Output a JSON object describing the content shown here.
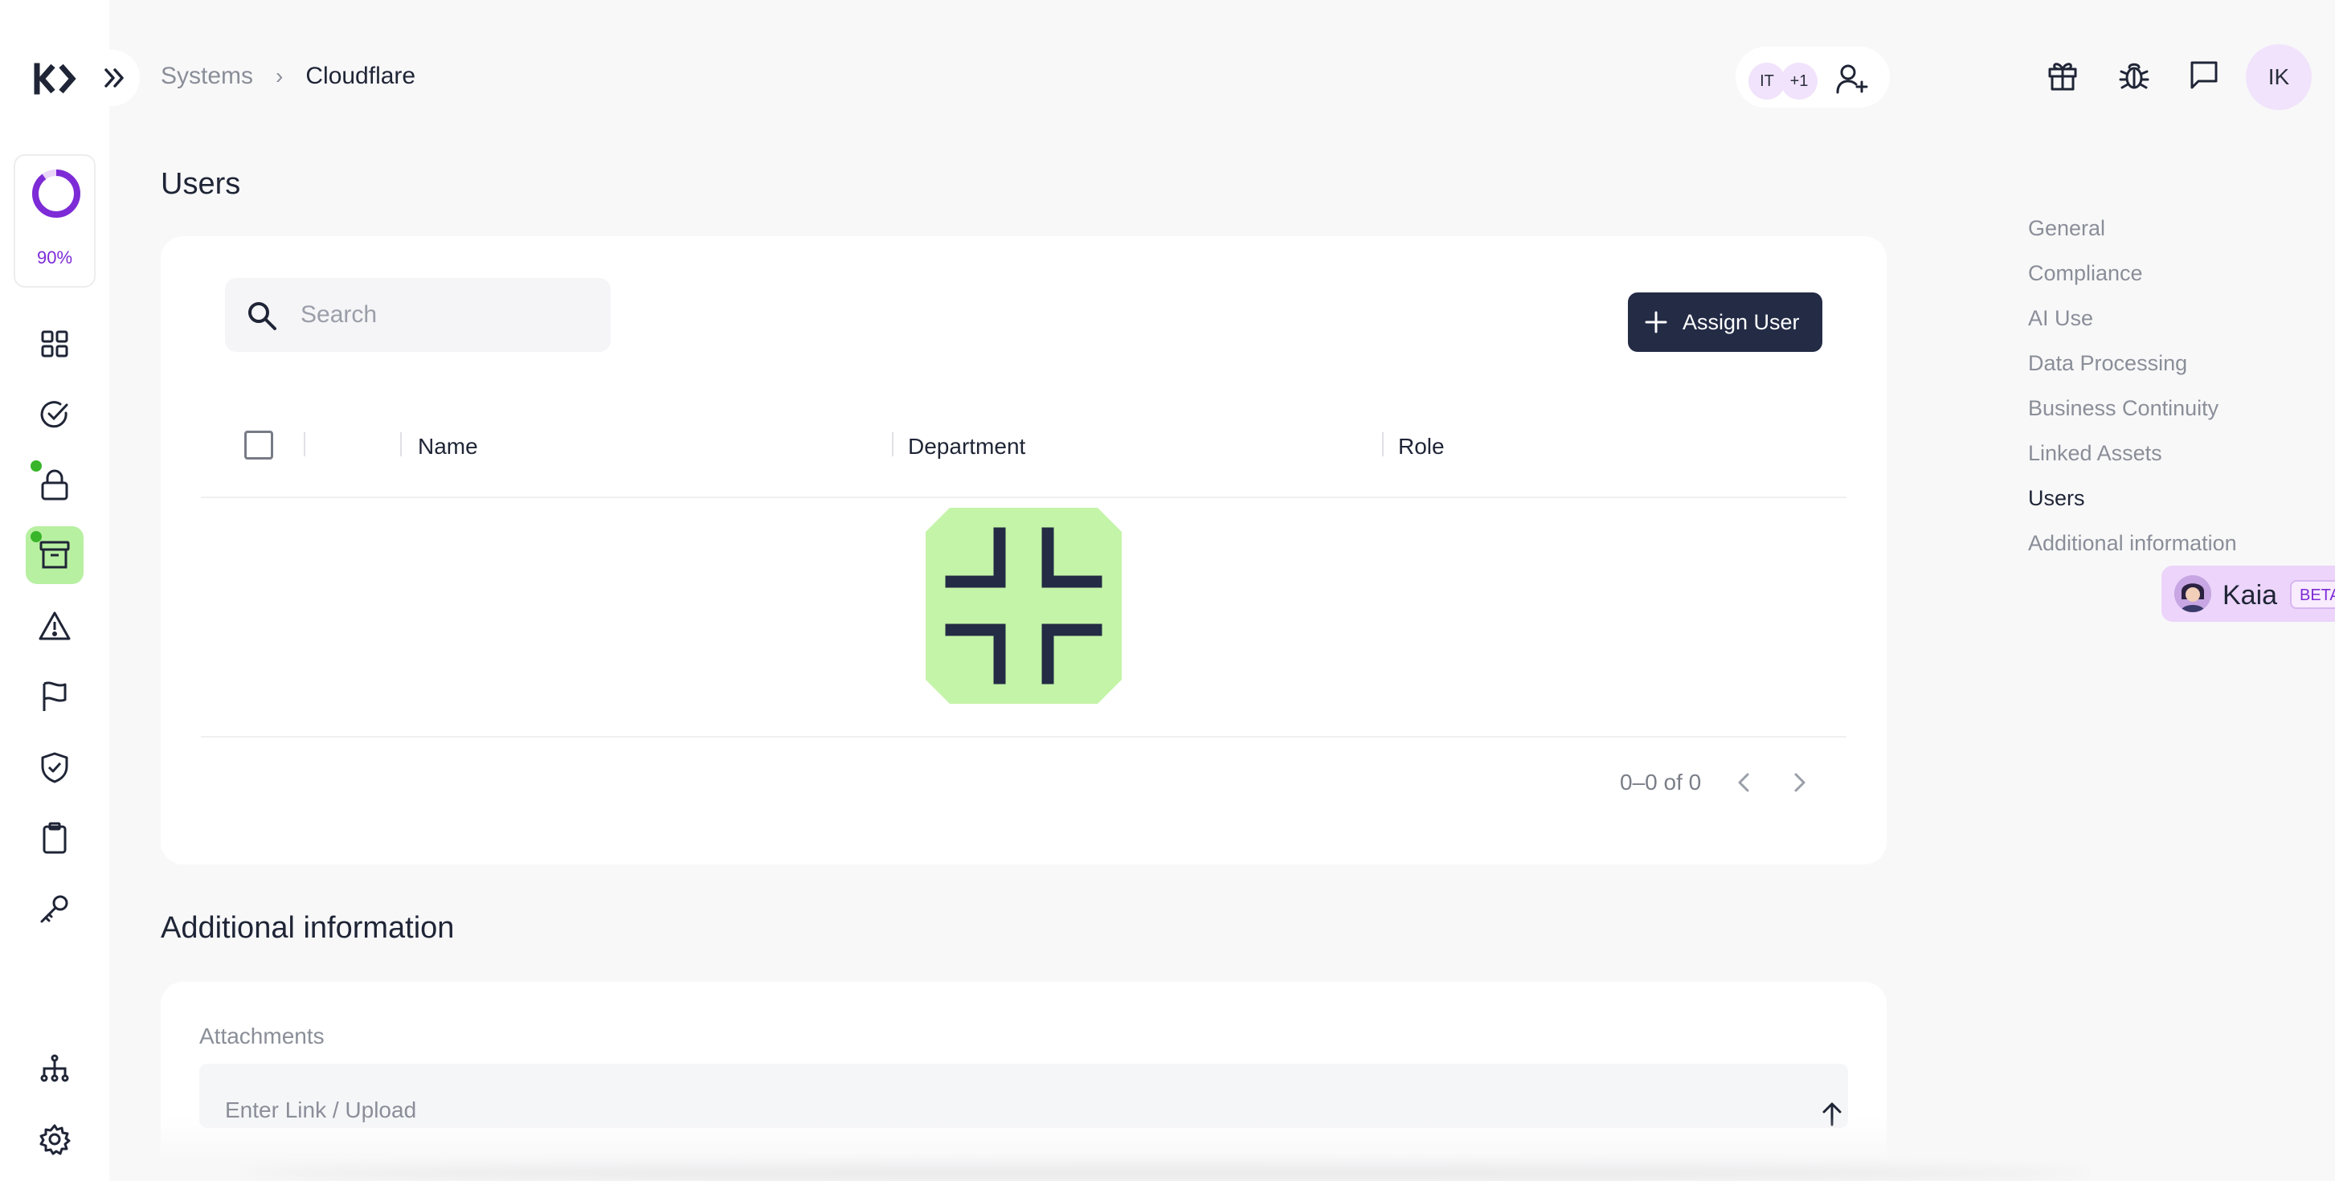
{
  "breadcrumb": {
    "parent": "Systems",
    "separator": "›",
    "current": "Cloudflare"
  },
  "sidebar": {
    "progress": {
      "value": 0.9,
      "label": "90%"
    },
    "items": [
      {
        "name": "dashboard",
        "icon": "grid-icon",
        "has_dot": false,
        "active": false
      },
      {
        "name": "tasks",
        "icon": "check-circle-icon",
        "has_dot": false,
        "active": false
      },
      {
        "name": "security",
        "icon": "lock-icon",
        "has_dot": true,
        "active": false
      },
      {
        "name": "systems",
        "icon": "archive-box-icon",
        "has_dot": true,
        "active": true
      },
      {
        "name": "risks",
        "icon": "warning-icon",
        "has_dot": false,
        "active": false
      },
      {
        "name": "issues",
        "icon": "flag-icon",
        "has_dot": false,
        "active": false
      },
      {
        "name": "compliance",
        "icon": "shield-check-icon",
        "has_dot": false,
        "active": false
      },
      {
        "name": "reports",
        "icon": "clipboard-icon",
        "has_dot": false,
        "active": false
      },
      {
        "name": "access",
        "icon": "key-icon",
        "has_dot": false,
        "active": false
      },
      {
        "name": "organization",
        "icon": "org-chart-icon",
        "has_dot": false,
        "active": false
      },
      {
        "name": "settings",
        "icon": "gear-icon",
        "has_dot": false,
        "active": false
      }
    ]
  },
  "header": {
    "owner_avatars": [
      "IT",
      "+1"
    ],
    "add_owner_icon": "user-plus-icon",
    "icons": [
      "gift-icon",
      "bug-icon",
      "chat-icon"
    ],
    "user_initials": "IK"
  },
  "users_section": {
    "title": "Users",
    "search_placeholder": "Search",
    "assign_button": "Assign User",
    "columns": [
      "Name",
      "Department",
      "Role"
    ],
    "rows": [],
    "pagination": "0–0 of 0"
  },
  "additional_section": {
    "title": "Additional information",
    "attachments_label": "Attachments",
    "link_placeholder": "Enter Link / Upload"
  },
  "toc": {
    "items": [
      "General",
      "Compliance",
      "AI Use",
      "Data Processing",
      "Business Continuity",
      "Linked Assets",
      "Users",
      "Additional information"
    ],
    "active": "Users"
  },
  "assistant": {
    "name": "Kaia",
    "badge": "BETA"
  },
  "colors": {
    "accent_purple": "#7d2bd6",
    "active_nav": "#b8f0a1",
    "primary_button": "#232b45",
    "status_dot": "#38b52a"
  }
}
